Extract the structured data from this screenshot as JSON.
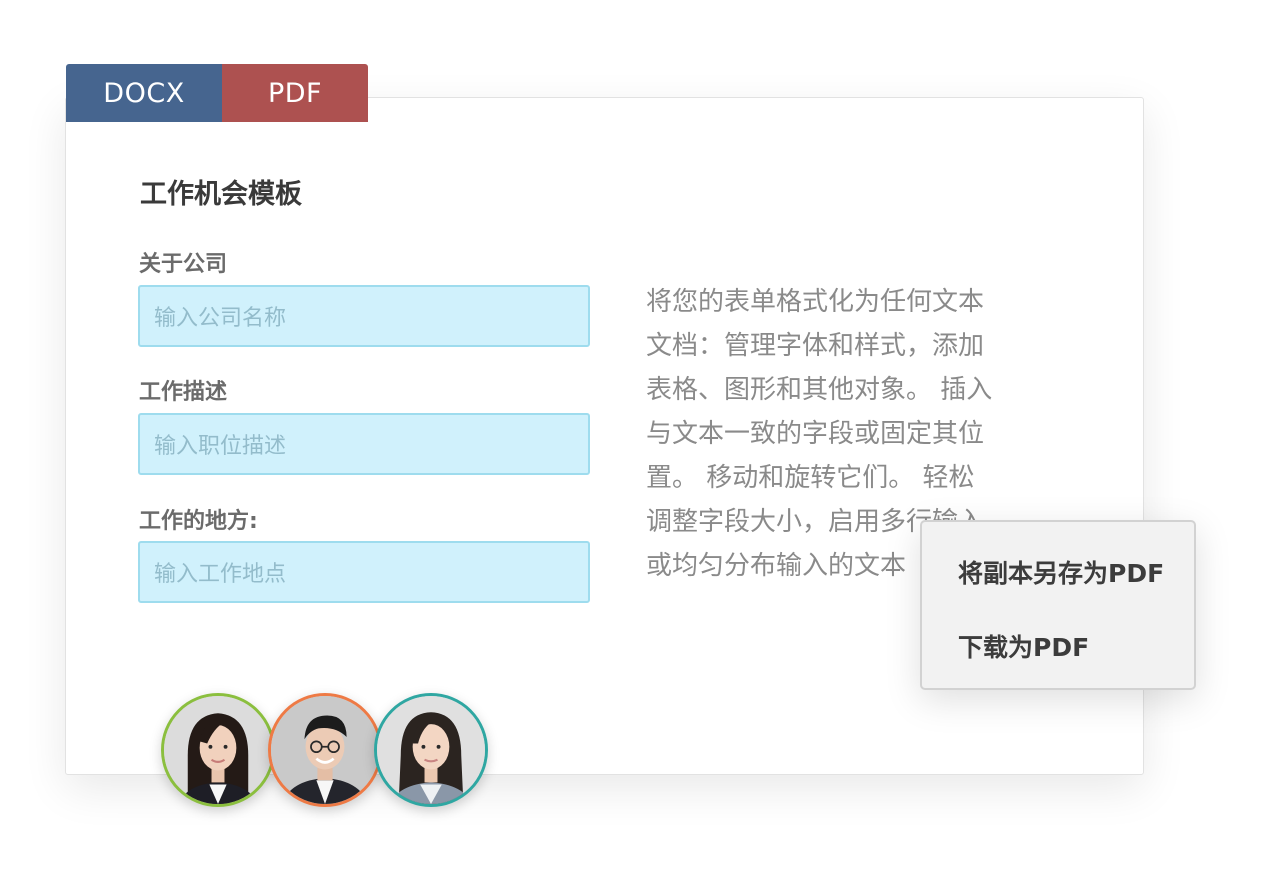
{
  "tabs": {
    "docx": {
      "label": "DOCX",
      "color": "#46658f"
    },
    "pdf": {
      "label": "PDF",
      "color": "#ad5150"
    }
  },
  "form": {
    "title": "工作机会模板",
    "fields": [
      {
        "label": "关于公司",
        "placeholder": "输入公司名称"
      },
      {
        "label": "工作描述",
        "placeholder": "输入职位描述"
      },
      {
        "label": "工作的地方:",
        "placeholder": "输入工作地点"
      }
    ]
  },
  "description": {
    "lines": [
      "将您的表单格式化为任何文本",
      "文档：管理字体和样式，添加",
      "表格、图形和其他对象。 插入",
      "与文本一致的字段或固定其位",
      "置。 移动和旋转它们。 轻松",
      "调整字段大小，启用多行输入",
      "或均匀分布输入的文本"
    ]
  },
  "context_menu": {
    "items": [
      "将副本另存为PDF",
      "下载为PDF"
    ]
  },
  "avatars": [
    {
      "name": "avatar-woman-1",
      "ring_color": "#8bbf3e"
    },
    {
      "name": "avatar-man",
      "ring_color": "#ee7a45"
    },
    {
      "name": "avatar-woman-2",
      "ring_color": "#2fa7a2"
    }
  ]
}
